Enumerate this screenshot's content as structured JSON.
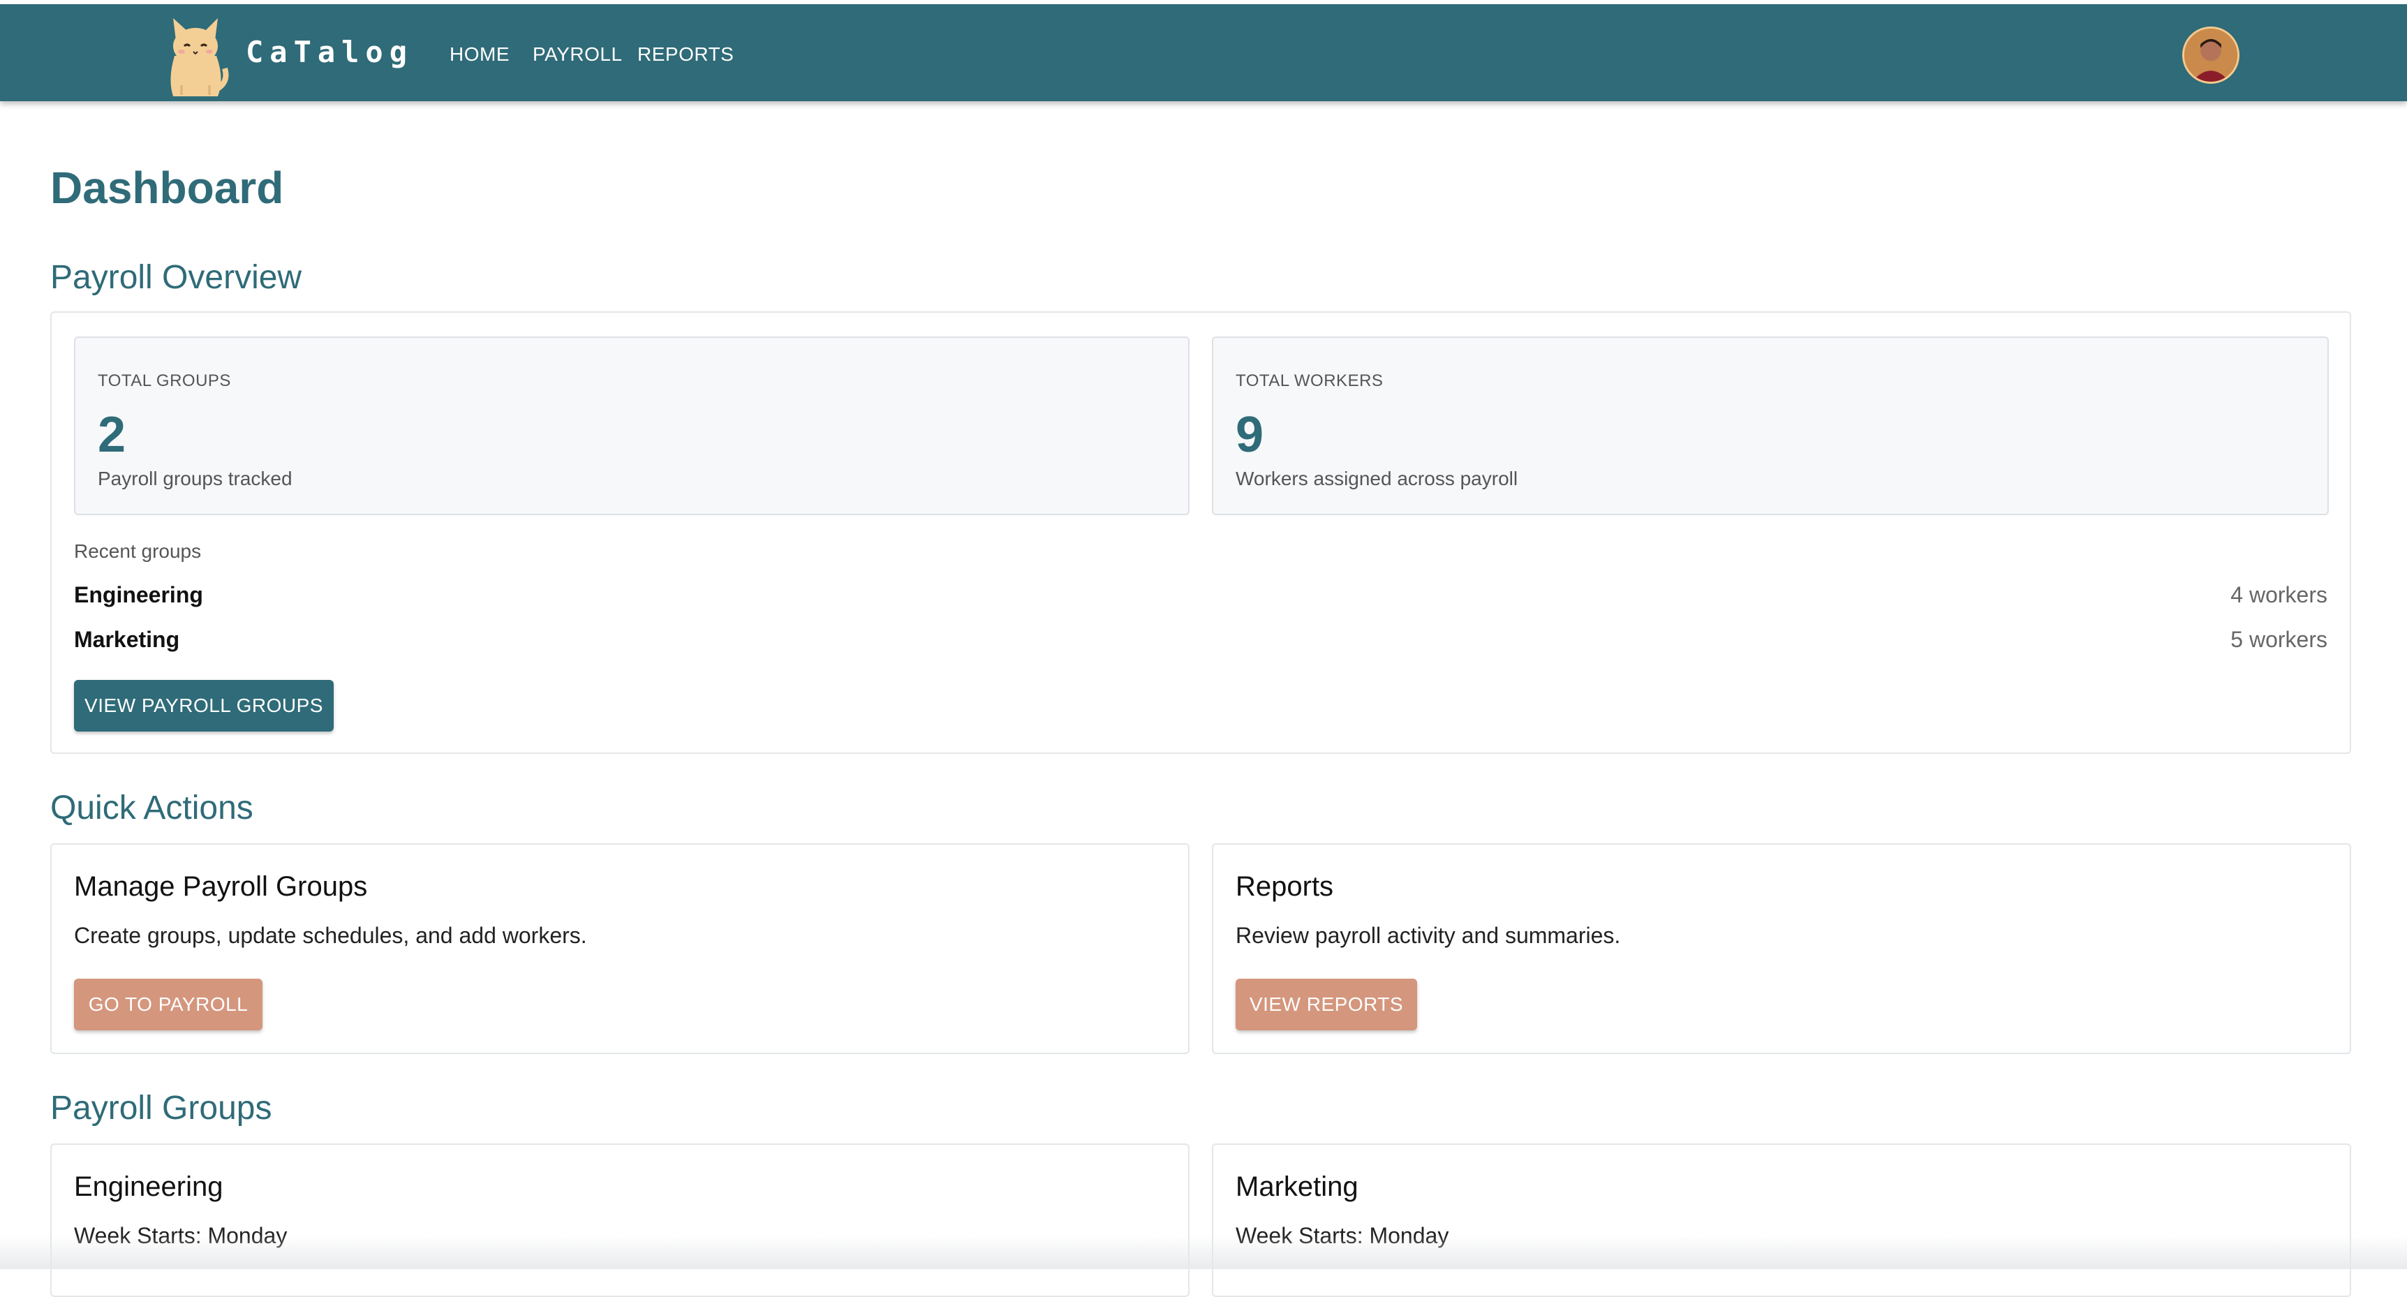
{
  "header": {
    "brand": "CaTalog",
    "nav": [
      "HOME",
      "PAYROLL",
      "REPORTS"
    ]
  },
  "page": {
    "title": "Dashboard"
  },
  "payroll_overview": {
    "title": "Payroll Overview",
    "stats": [
      {
        "label": "TOTAL GROUPS",
        "value": "2",
        "sub": "Payroll groups tracked"
      },
      {
        "label": "TOTAL WORKERS",
        "value": "9",
        "sub": "Workers assigned across payroll"
      }
    ],
    "recent_label": "Recent groups",
    "recent": [
      {
        "name": "Engineering",
        "count": "4 workers"
      },
      {
        "name": "Marketing",
        "count": "5 workers"
      }
    ],
    "button": "VIEW PAYROLL GROUPS"
  },
  "quick_actions": {
    "title": "Quick Actions",
    "cards": [
      {
        "title": "Manage Payroll Groups",
        "text": "Create groups, update schedules, and add workers.",
        "button": "GO TO PAYROLL"
      },
      {
        "title": "Reports",
        "text": "Review payroll activity and summaries.",
        "button": "VIEW REPORTS"
      }
    ]
  },
  "payroll_groups": {
    "title": "Payroll Groups",
    "groups": [
      {
        "name": "Engineering",
        "week": "Week Starts: Monday"
      },
      {
        "name": "Marketing",
        "week": "Week Starts: Monday"
      }
    ]
  },
  "colors": {
    "primary": "#2f6b78",
    "accent": "#d4967d"
  },
  "icons": {
    "logo": "cat-logo-icon",
    "avatar": "user-avatar"
  }
}
